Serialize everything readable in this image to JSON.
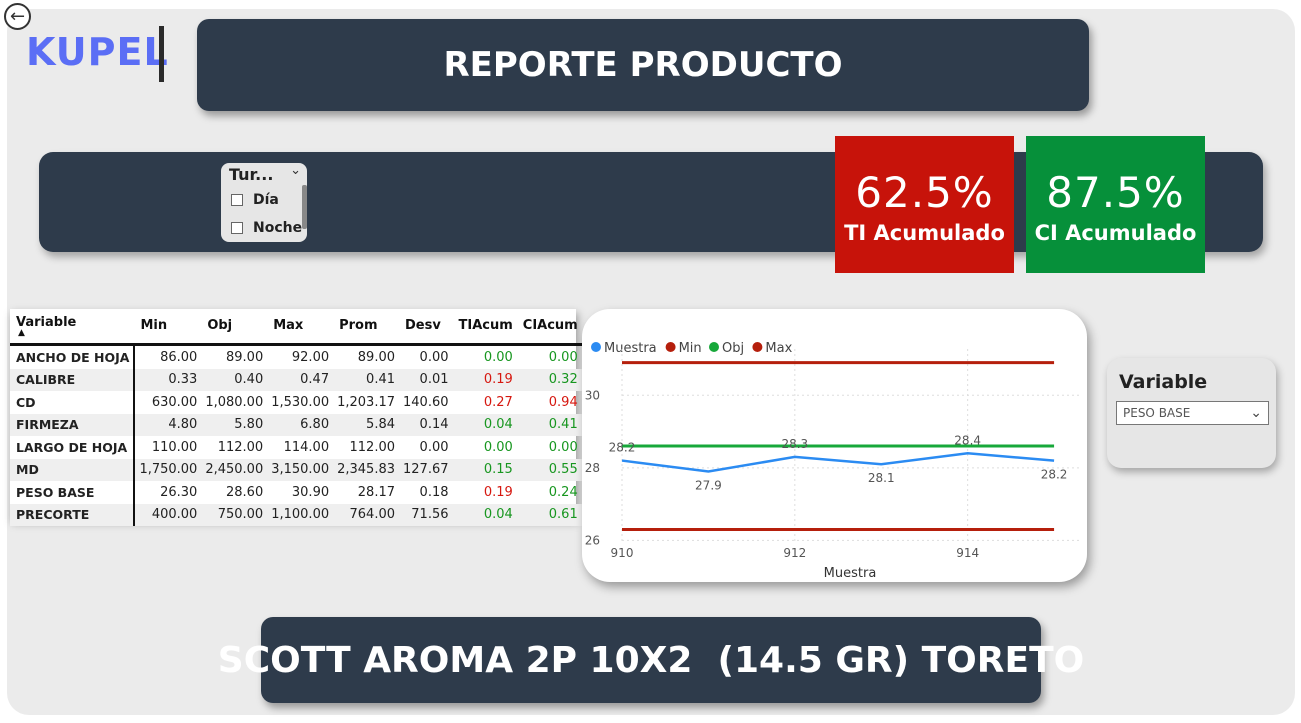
{
  "header": {
    "logo": "KUPEL",
    "title": "REPORTE PRODUCTO",
    "back_icon": "arrow-left-circle-icon"
  },
  "slicer_turno": {
    "title": "Tur...",
    "options": [
      "Día",
      "Noche"
    ]
  },
  "kpis": {
    "ti": {
      "value": "62.5%",
      "label": "TI Acumulado",
      "color": "#c7130a"
    },
    "ci": {
      "value": "87.5%",
      "label": "CI Acumulado",
      "color": "#06903a"
    }
  },
  "table": {
    "headers": [
      "Variable",
      "Min",
      "Obj",
      "Max",
      "Prom",
      "Desv",
      "TIAcum",
      "CIAcum"
    ],
    "rows": [
      [
        "ANCHO DE HOJA",
        "86.00",
        "89.00",
        "92.00",
        "89.00",
        "0.00",
        "0.00",
        "0.00"
      ],
      [
        "CALIBRE",
        "0.33",
        "0.40",
        "0.47",
        "0.41",
        "0.01",
        "0.19",
        "0.32"
      ],
      [
        "CD",
        "630.00",
        "1,080.00",
        "1,530.00",
        "1,203.17",
        "140.60",
        "0.27",
        "0.94"
      ],
      [
        "FIRMEZA",
        "4.80",
        "5.80",
        "6.80",
        "5.84",
        "0.14",
        "0.04",
        "0.41"
      ],
      [
        "LARGO DE HOJA",
        "110.00",
        "112.00",
        "114.00",
        "112.00",
        "0.00",
        "0.00",
        "0.00"
      ],
      [
        "MD",
        "1,750.00",
        "2,450.00",
        "3,150.00",
        "2,345.83",
        "127.67",
        "0.15",
        "0.55"
      ],
      [
        "PESO BASE",
        "26.30",
        "28.60",
        "30.90",
        "28.17",
        "0.18",
        "0.19",
        "0.24"
      ],
      [
        "PRECORTE",
        "400.00",
        "750.00",
        "1,100.00",
        "764.00",
        "71.56",
        "0.04",
        "0.61"
      ]
    ],
    "ti_status": [
      "green",
      "red",
      "red",
      "green",
      "green",
      "green",
      "red",
      "green"
    ],
    "ci_status": [
      "green",
      "green",
      "red",
      "green",
      "green",
      "green",
      "green",
      "green"
    ]
  },
  "chart_data": {
    "type": "line",
    "xlabel": "Muestra",
    "ylabel": "",
    "x": [
      910,
      911,
      912,
      913,
      914,
      915
    ],
    "x_ticks": [
      "910",
      "912",
      "914"
    ],
    "y_ticks": [
      "26",
      "28",
      "30"
    ],
    "ylim": [
      25.9,
      31.0
    ],
    "legend_position": "top-left",
    "grid": true,
    "series": [
      {
        "name": "Muestra",
        "color": "#2b8bf2",
        "values": [
          28.2,
          27.9,
          28.3,
          28.1,
          28.4,
          28.2
        ],
        "labels": true
      },
      {
        "name": "Min",
        "color": "#b51f0c",
        "values": [
          26.3,
          26.3,
          26.3,
          26.3,
          26.3,
          26.3
        ]
      },
      {
        "name": "Obj",
        "color": "#17a83a",
        "values": [
          28.6,
          28.6,
          28.6,
          28.6,
          28.6,
          28.6
        ]
      },
      {
        "name": "Max",
        "color": "#b51f0c",
        "values": [
          30.9,
          30.9,
          30.9,
          30.9,
          30.9,
          30.9
        ]
      }
    ]
  },
  "variable_slicer": {
    "title": "Variable",
    "selected": "PESO BASE",
    "chevron_icon": "chevron-down-icon"
  },
  "product": {
    "name": "SCOTT AROMA 2P 10X2  (14.5 GR) TORETO"
  }
}
